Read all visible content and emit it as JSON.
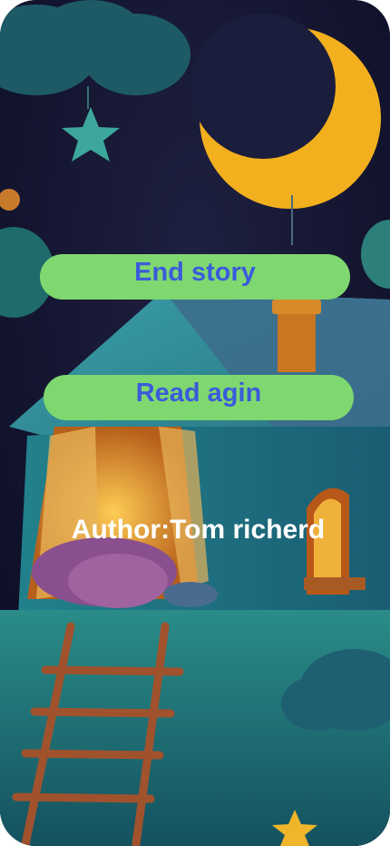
{
  "buttons": {
    "end_story": "End story",
    "read_again": "Read agin"
  },
  "author_label": "Author:Tom richerd",
  "colors": {
    "button_bg": "#7fd86f",
    "button_text": "#3b5bdb",
    "sky": "#0d0f2a",
    "moon": "#f2b01e",
    "roof": "#2f8f95",
    "ground": "#1f7a7a",
    "ladder": "#a0522d"
  },
  "illustration": {
    "elements": [
      "moon",
      "star",
      "clouds",
      "house",
      "chimney",
      "lit-window",
      "ladder",
      "pillow"
    ]
  }
}
